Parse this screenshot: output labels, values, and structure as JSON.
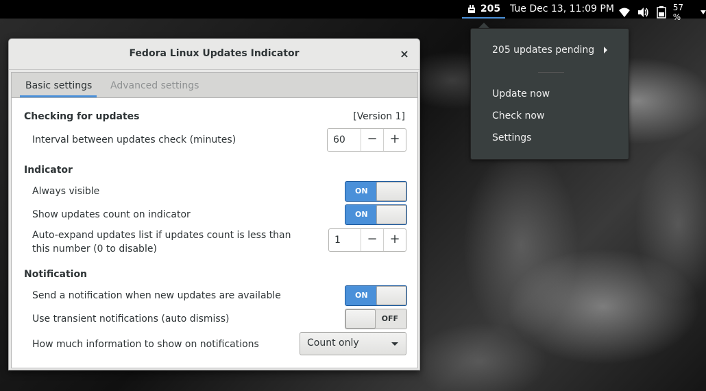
{
  "topbar": {
    "update_count": "205",
    "clock": "Tue Dec 13, 11:09 PM",
    "battery": "57 %",
    "icons": [
      "updates-icon",
      "wifi-icon",
      "volume-icon",
      "battery-icon",
      "menu-arrow-icon"
    ]
  },
  "menu": {
    "pending": "205 updates pending",
    "update_now": "Update now",
    "check_now": "Check now",
    "settings": "Settings"
  },
  "dialog": {
    "title": "Fedora Linux Updates Indicator",
    "close": "×",
    "tabs": [
      "Basic settings",
      "Advanced settings"
    ]
  },
  "settings": {
    "section_checking": "Checking for updates",
    "version": "[Version 1]",
    "interval_label": "Interval between updates check (minutes)",
    "interval_value": "60",
    "section_indicator": "Indicator",
    "always_visible_label": "Always visible",
    "always_visible_state": "ON",
    "show_count_label": "Show updates count on indicator",
    "show_count_state": "ON",
    "auto_expand_label": "Auto-expand updates list if updates count is less than this number (0 to disable)",
    "auto_expand_value": "1",
    "section_notification": "Notification",
    "send_notif_label": "Send a notification when new updates are available",
    "send_notif_state": "ON",
    "transient_label": "Use transient notifications (auto dismiss)",
    "transient_state": "OFF",
    "info_label": "How much information to show on notifications",
    "info_value": "Count only",
    "minus": "−",
    "plus": "+"
  },
  "colors": {
    "accent": "#4a90d9",
    "menu_bg": "#393f3f",
    "topbar_bg": "#000000"
  }
}
